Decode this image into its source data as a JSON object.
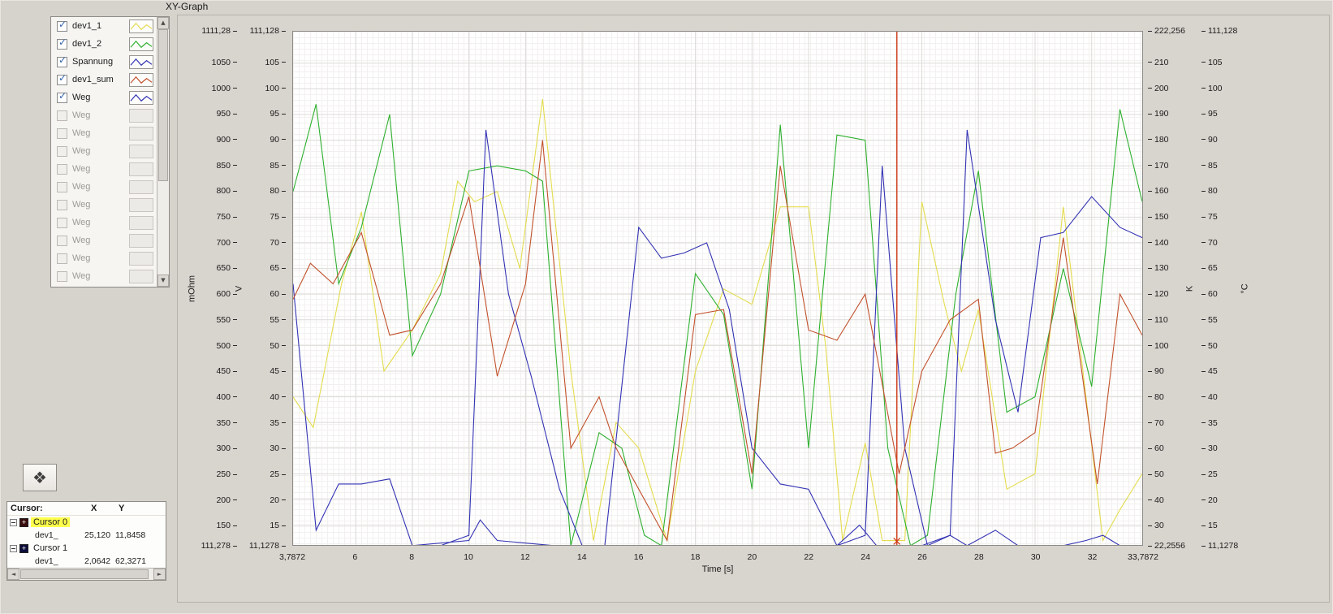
{
  "title": "XY-Graph",
  "icons": {
    "scroll_up": "▲",
    "scroll_down": "▼",
    "scroll_left": "◄",
    "scroll_right": "►",
    "palette": "❖",
    "check": "✓",
    "cursor_cross": "+"
  },
  "legend": {
    "items": [
      {
        "label": "dev1_1",
        "enabled": true,
        "color": "#e4dc4e"
      },
      {
        "label": "dev1_2",
        "enabled": true,
        "color": "#2eb02e"
      },
      {
        "label": "Spannung",
        "enabled": true,
        "color": "#3232b4"
      },
      {
        "label": "dev1_sum",
        "enabled": true,
        "color": "#c2512c"
      },
      {
        "label": "Weg",
        "enabled": true,
        "color": "#3232b4"
      },
      {
        "label": "Weg",
        "enabled": false,
        "color": "#c6c3bf"
      },
      {
        "label": "Weg",
        "enabled": false,
        "color": "#c6c3bf"
      },
      {
        "label": "Weg",
        "enabled": false,
        "color": "#c6c3bf"
      },
      {
        "label": "Weg",
        "enabled": false,
        "color": "#c6c3bf"
      },
      {
        "label": "Weg",
        "enabled": false,
        "color": "#c6c3bf"
      },
      {
        "label": "Weg",
        "enabled": false,
        "color": "#c6c3bf"
      },
      {
        "label": "Weg",
        "enabled": false,
        "color": "#c6c3bf"
      },
      {
        "label": "Weg",
        "enabled": false,
        "color": "#c6c3bf"
      },
      {
        "label": "Weg",
        "enabled": false,
        "color": "#c6c3bf"
      },
      {
        "label": "Weg",
        "enabled": false,
        "color": "#c6c3bf"
      }
    ]
  },
  "axes": {
    "y_mohm": {
      "label": "mOhm",
      "top_label": "1111,28",
      "bottom_label": "111,278",
      "ticks": [
        "1050",
        "1000",
        "950",
        "900",
        "850",
        "800",
        "750",
        "700",
        "650",
        "600",
        "550",
        "500",
        "450",
        "400",
        "350",
        "300",
        "250",
        "200",
        "150"
      ]
    },
    "y_v": {
      "label": "V",
      "top_label": "111,128",
      "bottom_label": "11,1278",
      "ticks": [
        "105",
        "100",
        "95",
        "90",
        "85",
        "80",
        "75",
        "70",
        "65",
        "60",
        "55",
        "50",
        "45",
        "40",
        "35",
        "30",
        "25",
        "20",
        "15"
      ]
    },
    "y_k": {
      "label": "K",
      "top_label": "222,256",
      "bottom_label": "22,2556",
      "ticks": [
        "210",
        "200",
        "190",
        "180",
        "170",
        "160",
        "150",
        "140",
        "130",
        "120",
        "110",
        "100",
        "90",
        "80",
        "70",
        "60",
        "50",
        "40",
        "30"
      ]
    },
    "y_c": {
      "label": "°C",
      "top_label": "111,128",
      "bottom_label": "11,1278",
      "ticks": [
        "105",
        "100",
        "95",
        "90",
        "85",
        "80",
        "75",
        "70",
        "65",
        "60",
        "55",
        "50",
        "45",
        "40",
        "35",
        "30",
        "25",
        "20",
        "15"
      ]
    },
    "x": {
      "label": "Time [s]",
      "left_label": "3,7872",
      "right_label": "33,7872",
      "ticks": [
        "6",
        "8",
        "10",
        "12",
        "14",
        "16",
        "18",
        "20",
        "22",
        "24",
        "26",
        "28",
        "30",
        "32"
      ]
    }
  },
  "chart_data": {
    "type": "line",
    "x_range": [
      3.7872,
      33.7872
    ],
    "y_ref": {
      "axis": "V",
      "min": 11.1278,
      "max": 111.128
    },
    "legend_position": "top-left panel",
    "grid": true,
    "series": [
      {
        "name": "dev1_1",
        "color": "#e4dc4e",
        "points": [
          [
            3.7872,
            40
          ],
          [
            4.5,
            34
          ],
          [
            5.5,
            62
          ],
          [
            6.2,
            76
          ],
          [
            7,
            45
          ],
          [
            8,
            53
          ],
          [
            9,
            64
          ],
          [
            9.6,
            82
          ],
          [
            10.2,
            78
          ],
          [
            11,
            80
          ],
          [
            11.8,
            65
          ],
          [
            12.6,
            98
          ],
          [
            13.6,
            45
          ],
          [
            14.4,
            12
          ],
          [
            15.2,
            35
          ],
          [
            16,
            30
          ],
          [
            17,
            12
          ],
          [
            18,
            45
          ],
          [
            19,
            61
          ],
          [
            20,
            58
          ],
          [
            21,
            77
          ],
          [
            22,
            77
          ],
          [
            22.6,
            50
          ],
          [
            23.2,
            12
          ],
          [
            24,
            31
          ],
          [
            24.6,
            12
          ],
          [
            25.4,
            12
          ],
          [
            26,
            78
          ],
          [
            26.8,
            58
          ],
          [
            27.4,
            45
          ],
          [
            28,
            57
          ],
          [
            29,
            22
          ],
          [
            30,
            25
          ],
          [
            31,
            77
          ],
          [
            31.8,
            40
          ],
          [
            32.4,
            12
          ],
          [
            33,
            18
          ],
          [
            33.7872,
            25
          ]
        ]
      },
      {
        "name": "dev1_2",
        "color": "#2eb02e",
        "points": [
          [
            3.7872,
            80
          ],
          [
            4.6,
            97
          ],
          [
            5.4,
            62
          ],
          [
            6.2,
            73
          ],
          [
            7.2,
            95
          ],
          [
            8,
            48
          ],
          [
            9,
            60
          ],
          [
            10,
            84
          ],
          [
            11,
            85
          ],
          [
            12,
            84
          ],
          [
            12.6,
            82
          ],
          [
            13.6,
            11
          ],
          [
            14.6,
            33
          ],
          [
            15.4,
            30
          ],
          [
            16.2,
            13
          ],
          [
            16.8,
            11
          ],
          [
            18,
            64
          ],
          [
            19,
            56
          ],
          [
            20,
            22
          ],
          [
            21,
            93
          ],
          [
            22,
            30
          ],
          [
            23,
            91
          ],
          [
            24,
            90
          ],
          [
            24.8,
            30
          ],
          [
            25.6,
            11
          ],
          [
            26.2,
            13
          ],
          [
            27.2,
            60
          ],
          [
            28,
            84
          ],
          [
            29,
            37
          ],
          [
            30,
            40
          ],
          [
            31,
            65
          ],
          [
            32,
            42
          ],
          [
            33,
            96
          ],
          [
            33.7872,
            78
          ]
        ]
      },
      {
        "name": "Spannung",
        "color": "#3232b4",
        "points": [
          [
            3.7872,
            62
          ],
          [
            4.6,
            14
          ],
          [
            5.4,
            23
          ],
          [
            6.2,
            23
          ],
          [
            7.2,
            24
          ],
          [
            8,
            11
          ],
          [
            9,
            11
          ],
          [
            10,
            13
          ],
          [
            10.6,
            92
          ],
          [
            11.4,
            60
          ],
          [
            12.2,
            44
          ],
          [
            13.2,
            22
          ],
          [
            14,
            11
          ],
          [
            14.8,
            11
          ],
          [
            16,
            73
          ],
          [
            16.8,
            67
          ],
          [
            17.6,
            68
          ],
          [
            18.4,
            70
          ],
          [
            19.2,
            57
          ],
          [
            20,
            30
          ],
          [
            21,
            23
          ],
          [
            22,
            22
          ],
          [
            23,
            11
          ],
          [
            24,
            13
          ],
          [
            24.6,
            85
          ],
          [
            25.4,
            30
          ],
          [
            26.2,
            11
          ],
          [
            27,
            13
          ],
          [
            27.6,
            92
          ],
          [
            28.6,
            55
          ],
          [
            29.4,
            37
          ],
          [
            30.2,
            71
          ],
          [
            31,
            72
          ],
          [
            32,
            79
          ],
          [
            33,
            73
          ],
          [
            33.7872,
            71
          ]
        ]
      },
      {
        "name": "dev1_sum",
        "color": "#c2512c",
        "points": [
          [
            3.7872,
            59
          ],
          [
            4.4,
            66
          ],
          [
            5.2,
            62
          ],
          [
            6.2,
            72
          ],
          [
            7.2,
            52
          ],
          [
            8,
            53
          ],
          [
            9,
            62
          ],
          [
            10,
            79
          ],
          [
            11,
            44
          ],
          [
            12,
            62
          ],
          [
            12.6,
            90
          ],
          [
            13.6,
            30
          ],
          [
            14.6,
            40
          ],
          [
            15.2,
            30
          ],
          [
            16,
            22
          ],
          [
            17,
            12
          ],
          [
            18,
            56
          ],
          [
            19,
            57
          ],
          [
            20,
            25
          ],
          [
            21,
            85
          ],
          [
            22,
            53
          ],
          [
            23,
            51
          ],
          [
            24,
            60
          ],
          [
            25.2,
            25
          ],
          [
            26,
            45
          ],
          [
            27,
            55
          ],
          [
            28,
            59
          ],
          [
            28.6,
            29
          ],
          [
            29.2,
            30
          ],
          [
            30,
            33
          ],
          [
            31,
            71
          ],
          [
            32.2,
            23
          ],
          [
            33,
            60
          ],
          [
            33.7872,
            52
          ]
        ]
      },
      {
        "name": "Weg",
        "color": "#3232b4",
        "points": [
          [
            3.7872,
            11
          ],
          [
            6,
            11
          ],
          [
            8,
            11
          ],
          [
            10,
            12
          ],
          [
            10.4,
            16
          ],
          [
            11,
            12
          ],
          [
            13,
            11
          ],
          [
            15,
            11
          ],
          [
            17,
            11
          ],
          [
            19,
            11
          ],
          [
            21,
            11
          ],
          [
            23,
            11
          ],
          [
            23.8,
            15
          ],
          [
            24.4,
            11
          ],
          [
            26,
            11
          ],
          [
            27,
            13
          ],
          [
            27.6,
            11
          ],
          [
            28.6,
            14
          ],
          [
            29.4,
            11
          ],
          [
            31,
            11
          ],
          [
            31.8,
            12
          ],
          [
            32.4,
            13
          ],
          [
            33,
            11
          ],
          [
            33.7872,
            11
          ]
        ]
      }
    ],
    "cursors": [
      {
        "name": "Cursor 0",
        "x": 25.12,
        "y": 11.8458,
        "color": "#cf3a16",
        "visible": true
      },
      {
        "name": "Cursor 1",
        "x": 2.064,
        "y": 62.3271,
        "color": "#10104a",
        "visible": false
      }
    ]
  },
  "cursor_panel": {
    "headers": {
      "name": "Cursor:",
      "x": "X",
      "y": "Y"
    },
    "cursors": [
      {
        "name": "Cursor 0",
        "highlighted": true,
        "icon_color": "#3a0d0d",
        "plot": "dev1_",
        "x_text": "25,120",
        "y_text": "11,8458"
      },
      {
        "name": "Cursor 1",
        "highlighted": false,
        "icon_color": "#0d0d3a",
        "plot": "dev1_",
        "x_text": "2,0642",
        "y_text": "62,3271"
      }
    ]
  }
}
